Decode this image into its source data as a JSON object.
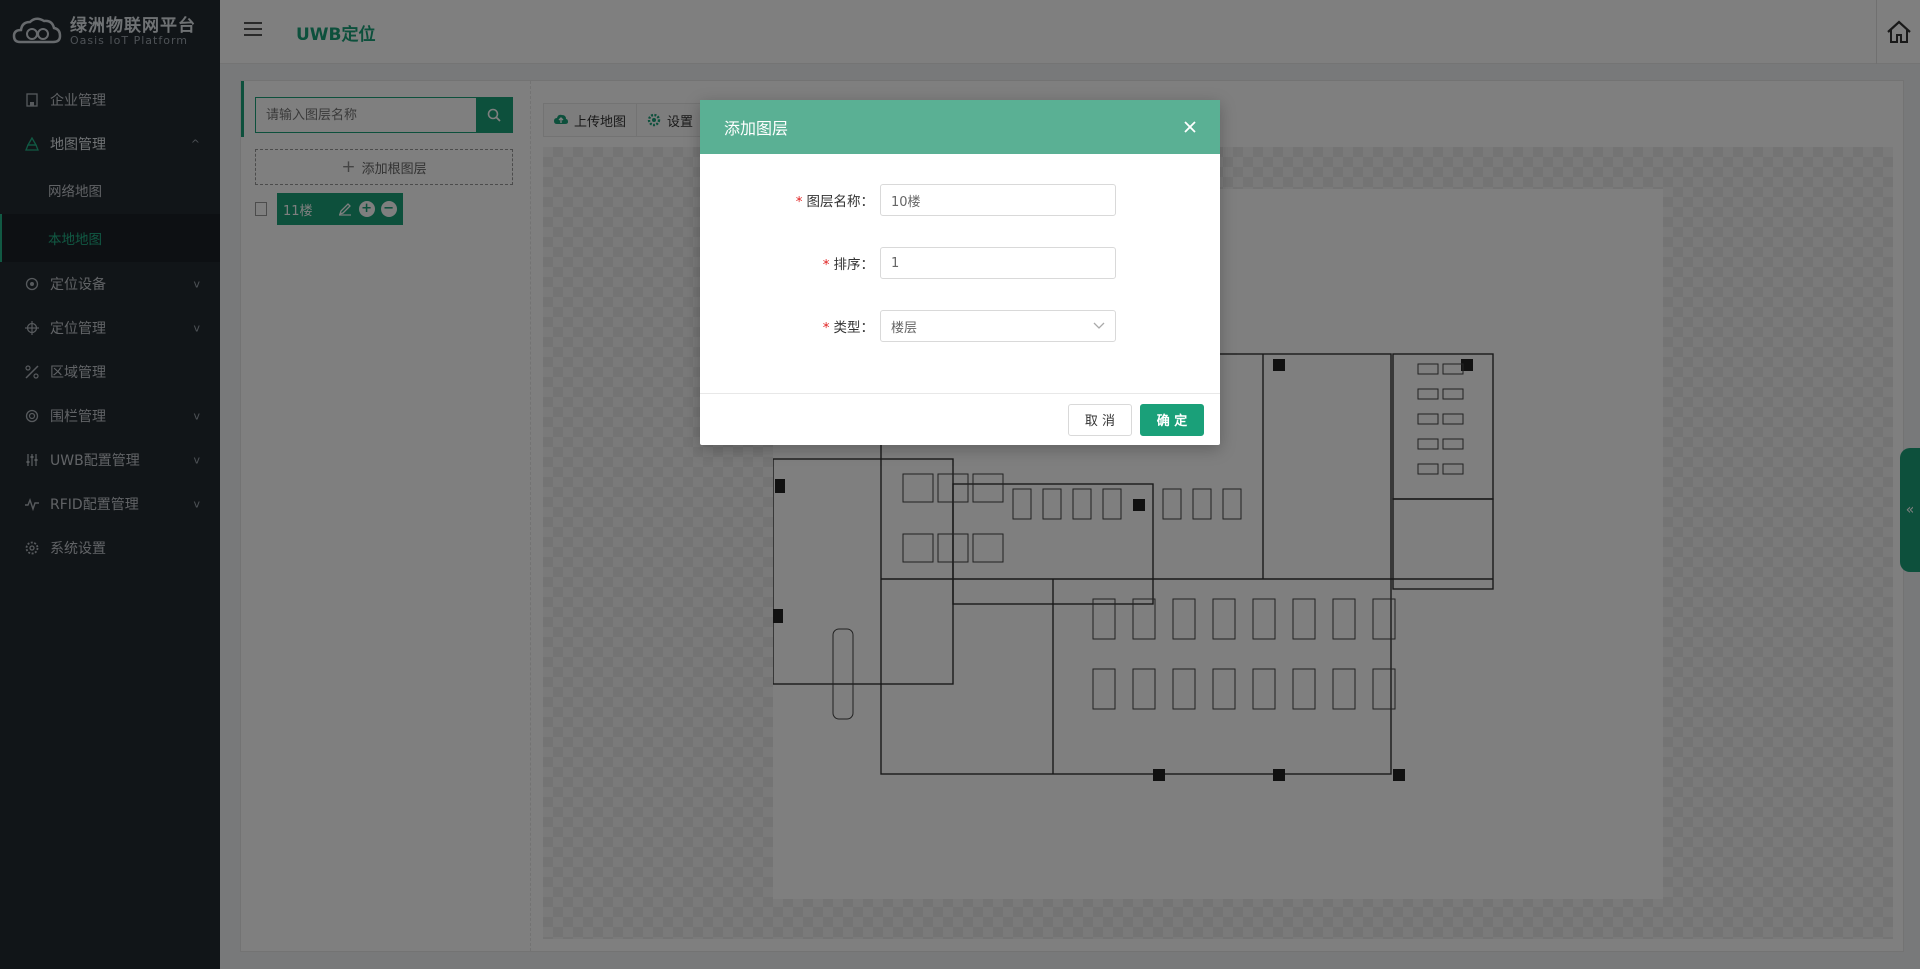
{
  "brand": {
    "title": "绿洲物联网平台",
    "subtitle": "Oasis IoT Platform"
  },
  "sidebar": {
    "items": [
      {
        "label": "企业管理",
        "icon": "building-icon"
      },
      {
        "label": "地图管理",
        "icon": "map-icon",
        "expanded": true,
        "children": [
          {
            "label": "网络地图"
          },
          {
            "label": "本地地图",
            "active": true
          }
        ]
      },
      {
        "label": "定位设备",
        "icon": "device-icon"
      },
      {
        "label": "定位管理",
        "icon": "location-icon"
      },
      {
        "label": "区域管理",
        "icon": "area-icon"
      },
      {
        "label": "围栏管理",
        "icon": "fence-icon"
      },
      {
        "label": "UWB配置管理",
        "icon": "sliders-icon"
      },
      {
        "label": "RFID配置管理",
        "icon": "rfid-icon"
      },
      {
        "label": "系统设置",
        "icon": "gear-icon"
      }
    ]
  },
  "header": {
    "title": "UWB定位"
  },
  "left_panel": {
    "search_placeholder": "请输入图层名称",
    "add_root_label": "添加根图层",
    "layers": [
      {
        "label": "11楼"
      }
    ]
  },
  "toolbar": {
    "upload_label": "上传地图",
    "settings_label": "设置"
  },
  "dialog": {
    "title": "添加图层",
    "fields": {
      "name": {
        "label": "图层名称：",
        "value": "10楼"
      },
      "order": {
        "label": "排序：",
        "value": "1"
      },
      "type": {
        "label": "类型：",
        "value": "楼层"
      }
    },
    "cancel_label": "取 消",
    "ok_label": "确 定"
  },
  "colors": {
    "accent": "#1aa079",
    "sidebar_bg": "#232a31",
    "dialog_header": "#5ab094"
  }
}
